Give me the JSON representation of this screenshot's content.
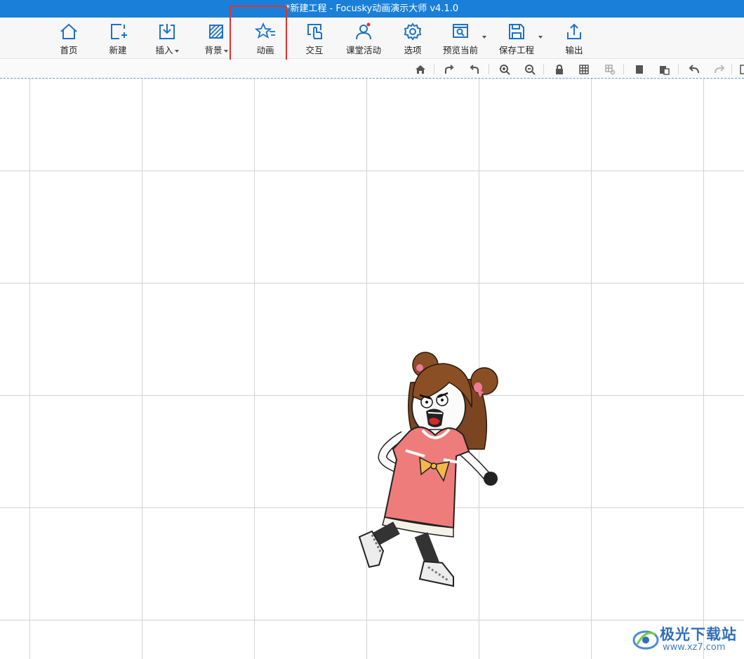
{
  "window": {
    "title": "*新建工程 - Focusky动画演示大师  v4.1.0"
  },
  "ribbon": {
    "home": "首页",
    "new": "新建",
    "insert": "插入",
    "background": "背景",
    "animation": "动画",
    "interaction": "交互",
    "class_activity": "课堂活动",
    "options": "选项",
    "preview_current": "预览当前",
    "save_project": "保存工程",
    "export": "输出"
  },
  "watermark": {
    "brand": "极光下载站",
    "url": "www.xz7.com"
  },
  "colors": {
    "titlebar": "#1a7fd8",
    "icon_blue": "#1b73c7",
    "highlight_red": "#e0322c",
    "grid_line": "#d3d3d3"
  }
}
